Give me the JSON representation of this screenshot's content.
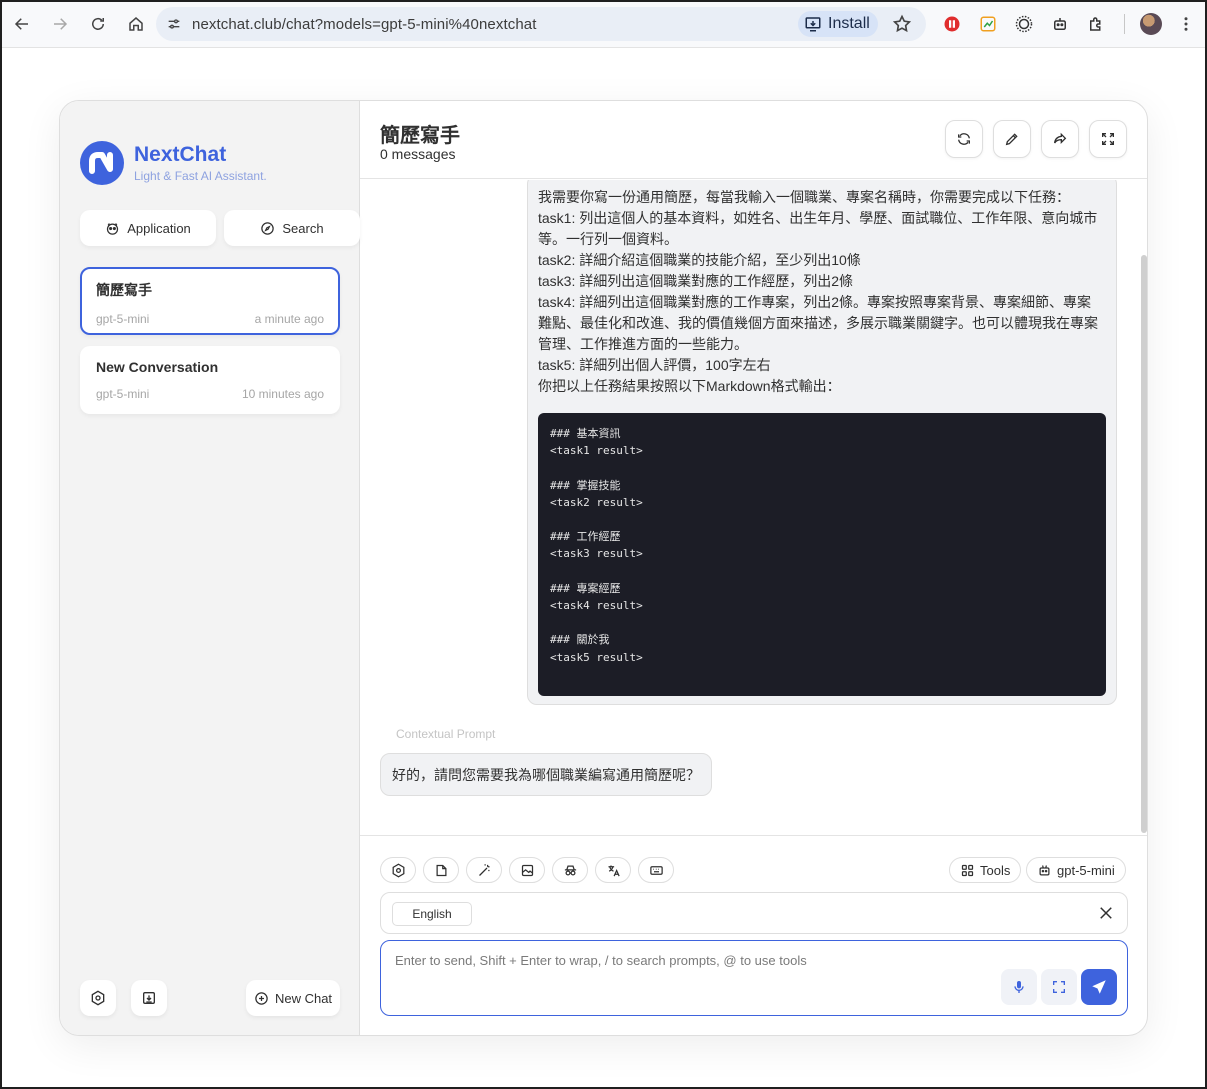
{
  "browser": {
    "url": "nextchat.club/chat?models=gpt-5-mini%40nextchat",
    "install_label": "Install"
  },
  "sidebar": {
    "brand_title": "NextChat",
    "brand_subtitle": "Light & Fast AI Assistant.",
    "application_label": "Application",
    "search_label": "Search",
    "chats": [
      {
        "title": "簡歷寫手",
        "model": "gpt-5-mini",
        "time": "a minute ago",
        "active": true
      },
      {
        "title": "New Conversation",
        "model": "gpt-5-mini",
        "time": "10 minutes ago",
        "active": false
      }
    ],
    "new_chat_label": "New Chat"
  },
  "header": {
    "title": "簡歷寫手",
    "subtitle": "0 messages"
  },
  "messages": {
    "user_lines": [
      "我需要你寫一份通用簡歷，每當我輸入一個職業、專案名稱時，你需要完成以下任務：",
      "task1: 列出這個人的基本資料，如姓名、出生年月、學歷、面試職位、工作年限、意向城市",
      "等。一行列一個資料。",
      "task2: 詳細介紹這個職業的技能介紹，至少列出10條",
      "task3: 詳細列出這個職業對應的工作經歷，列出2條",
      "task4: 詳細列出這個職業對應的工作專案，列出2條。專案按照專案背景、專案細節、專案",
      "難點、最佳化和改進、我的價值幾個方面來描述，多展示職業關鍵字。也可以體現我在專案",
      "管理、工作推進方面的一些能力。",
      "task5: 詳細列出個人評價，100字左右",
      "你把以上任務結果按照以下Markdown格式輸出："
    ],
    "code_lines": [
      "### 基本資訊",
      "<task1 result>",
      "",
      "### 掌握技能",
      "<task2 result>",
      "",
      "### 工作經歷",
      "<task3 result>",
      "",
      "### 專案經歷",
      "<task4 result>",
      "",
      "### 關於我",
      "<task5 result>"
    ],
    "contextual_label": "Contextual Prompt",
    "bot_reply": "好的，請問您需要我為哪個職業編寫通用簡歷呢？"
  },
  "input": {
    "tools_label": "Tools",
    "model_label": "gpt-5-mini",
    "language_chip": "English",
    "placeholder": "Enter to send, Shift + Enter to wrap, / to search prompts, @ to use tools"
  },
  "colors": {
    "accent": "#3e63dd",
    "code_bg": "#1c1d26",
    "bubble_bg": "#f1f2f4"
  }
}
